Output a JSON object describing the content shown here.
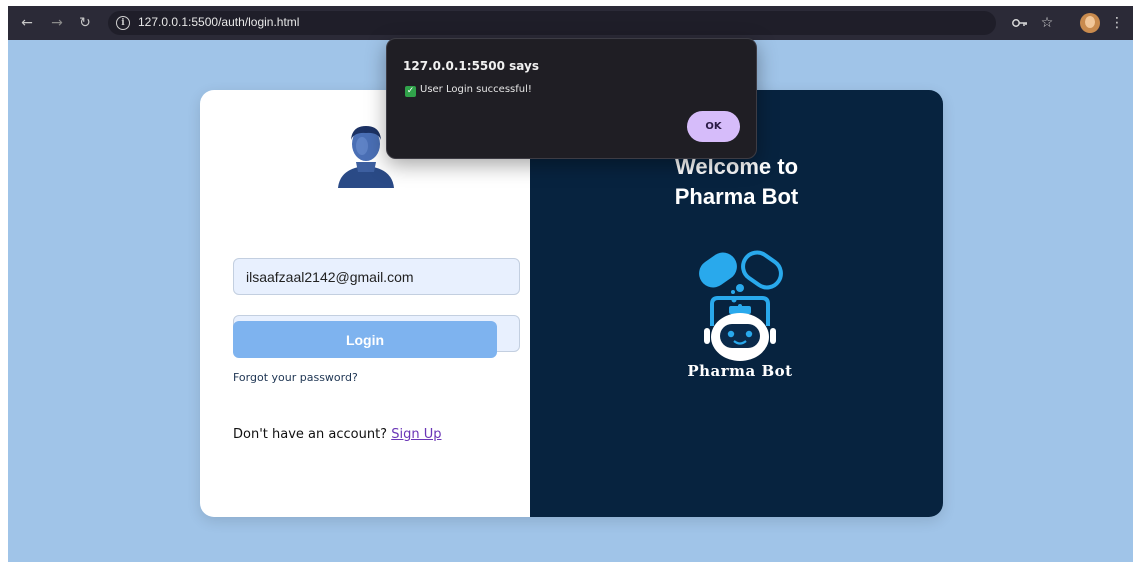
{
  "browser": {
    "url": "127.0.0.1:5500/auth/login.html",
    "back_icon": "arrow-left-icon",
    "forward_icon": "arrow-right-icon",
    "reload_icon": "reload-icon"
  },
  "login": {
    "email_value": "ilsaafzaal2142@gmail.com",
    "password_value": "•••",
    "login_label": "Login",
    "forgot_label": "Forgot your password?",
    "no_account_text": "Don't have an account?",
    "signup_label": "Sign Up"
  },
  "welcome": {
    "line1": "Welcome to",
    "line2": "Pharma Bot",
    "logo_name": "Pharma Bot"
  },
  "alert": {
    "title": "127.0.0.1:5500 says",
    "message": "User Login successful!",
    "ok_label": "OK"
  },
  "colors": {
    "background": "#a0c4e8",
    "panel_dark": "#07233f",
    "login_button": "#7eb3ef",
    "ok_button": "#d6bcfa",
    "link": "#6a35b6"
  }
}
